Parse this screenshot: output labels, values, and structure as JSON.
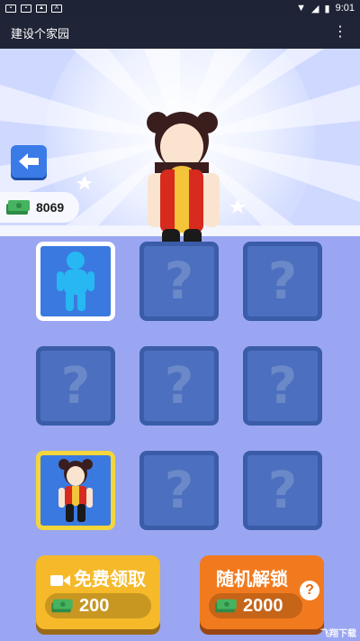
{
  "status_bar": {
    "time": "9:01",
    "notif_icons": [
      "notification-icon-1",
      "notification-icon-2",
      "image-icon",
      "a-icon"
    ]
  },
  "app_bar": {
    "title": "建设个家园",
    "menu_icon": "more-vertical-icon"
  },
  "currency": {
    "amount": "8069",
    "icon": "cash-icon"
  },
  "grid": {
    "cells": [
      {
        "state": "selected",
        "character": "blue-figure"
      },
      {
        "state": "locked",
        "label": "?"
      },
      {
        "state": "locked",
        "label": "?"
      },
      {
        "state": "locked",
        "label": "?"
      },
      {
        "state": "locked",
        "label": "?"
      },
      {
        "state": "locked",
        "label": "?"
      },
      {
        "state": "owned",
        "character": "girl-with-buns"
      },
      {
        "state": "locked",
        "label": "?"
      },
      {
        "state": "locked",
        "label": "?"
      }
    ]
  },
  "buttons": {
    "free": {
      "label": "免费领取",
      "price": "200",
      "icon": "video-icon"
    },
    "random": {
      "label": "随机解锁",
      "price": "2000",
      "help": "?"
    }
  },
  "watermark": "飞翔下载",
  "colors": {
    "accent": "#3b7be8",
    "gold": "#f5b92a",
    "orange": "#f27a1e",
    "bg": "#9aa6f2"
  }
}
